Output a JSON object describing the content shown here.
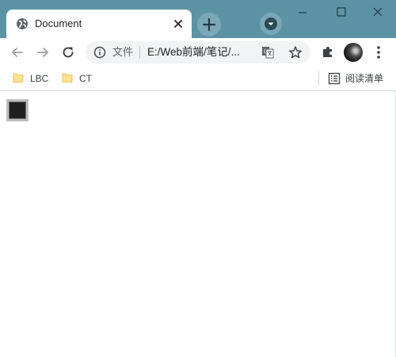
{
  "window": {
    "title_bar_color": "#5b93a4",
    "controls": {
      "minimize_icon": "minimize-icon",
      "maximize_icon": "maximize-icon",
      "close_icon": "window-close-icon"
    }
  },
  "tabs": [
    {
      "title": "Document",
      "active": true,
      "favicon": "globe-icon"
    }
  ],
  "toolbar": {
    "back_icon": "back-arrow-icon",
    "forward_icon": "forward-arrow-icon",
    "reload_icon": "reload-icon",
    "omnibox": {
      "scheme_label": "文件",
      "url": "E:/Web前端/笔记/..."
    },
    "translate_icon": "translate-icon",
    "bookmark_star_icon": "star-icon",
    "extensions_icon": "puzzle-icon",
    "menu_icon": "more-vert-icon"
  },
  "bookmarks": [
    {
      "label": "LBC",
      "icon": "folder-icon"
    },
    {
      "label": "CT",
      "icon": "folder-icon"
    }
  ],
  "reading_list": {
    "label": "阅读清单",
    "icon": "reading-list-icon"
  }
}
